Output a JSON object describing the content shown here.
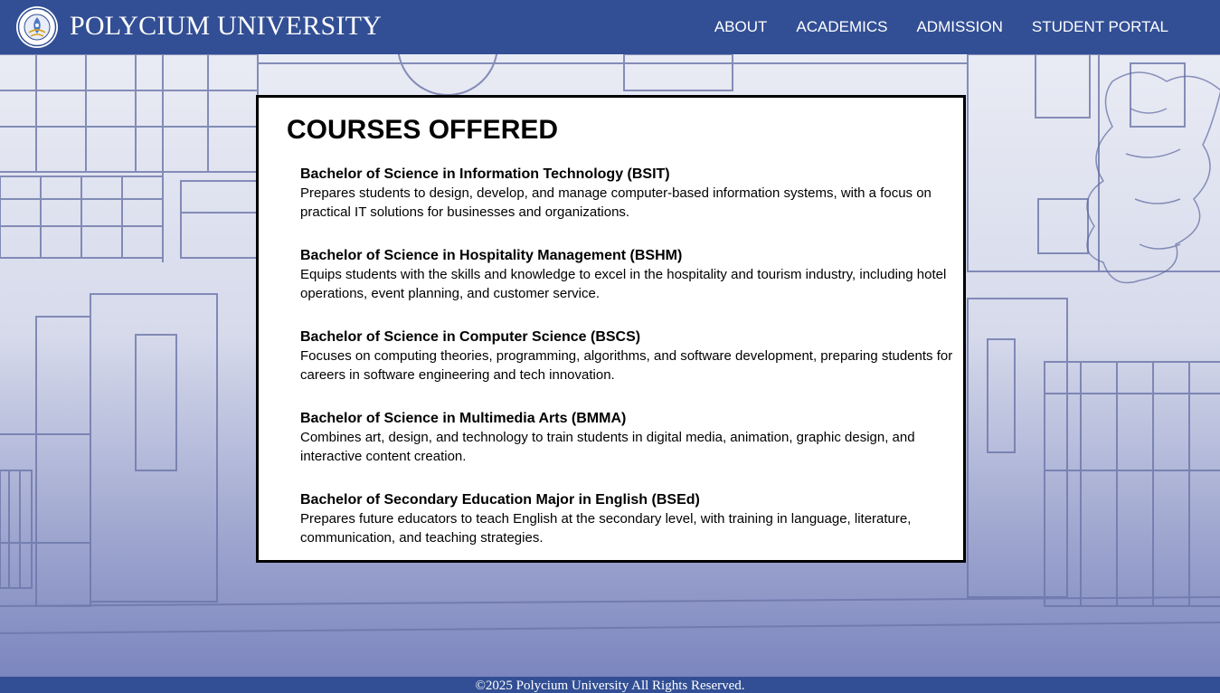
{
  "header": {
    "brand": "POLYCIUM UNIVERSITY",
    "logo_icon": "university-seal-icon",
    "nav": [
      {
        "label": "ABOUT"
      },
      {
        "label": "ACADEMICS"
      },
      {
        "label": "ADMISSION"
      },
      {
        "label": "STUDENT PORTAL"
      }
    ]
  },
  "main": {
    "title": "COURSES OFFERED",
    "courses": [
      {
        "name": "Bachelor of Science in Information Technology (BSIT)",
        "description": "Prepares students to design, develop, and manage computer-based information systems, with a focus on practical IT solutions for businesses and organizations."
      },
      {
        "name": "Bachelor of Science in Hospitality Management (BSHM)",
        "description": "Equips students with the skills and knowledge to excel in the hospitality and tourism industry, including hotel operations, event planning, and customer service."
      },
      {
        "name": "Bachelor of Science in Computer Science (BSCS)",
        "description": "Focuses on computing theories, programming, algorithms, and software development, preparing students for careers in software engineering and tech innovation."
      },
      {
        "name": "Bachelor of Science in Multimedia Arts (BMMA)",
        "description": "Combines art, design, and technology to train students in digital media, animation, graphic design, and interactive content creation."
      },
      {
        "name": "Bachelor of Secondary Education Major in English (BSEd)",
        "description": "Prepares future educators to teach English at the secondary level, with training in language, literature, communication, and teaching strategies."
      }
    ]
  },
  "footer": {
    "copyright": "©2025 Polycium University All Rights Reserved."
  },
  "colors": {
    "header_bg": "#324f95",
    "footer_bg": "#324f95",
    "card_bg": "#ffffff",
    "card_border": "#000000",
    "text": "#000000"
  }
}
